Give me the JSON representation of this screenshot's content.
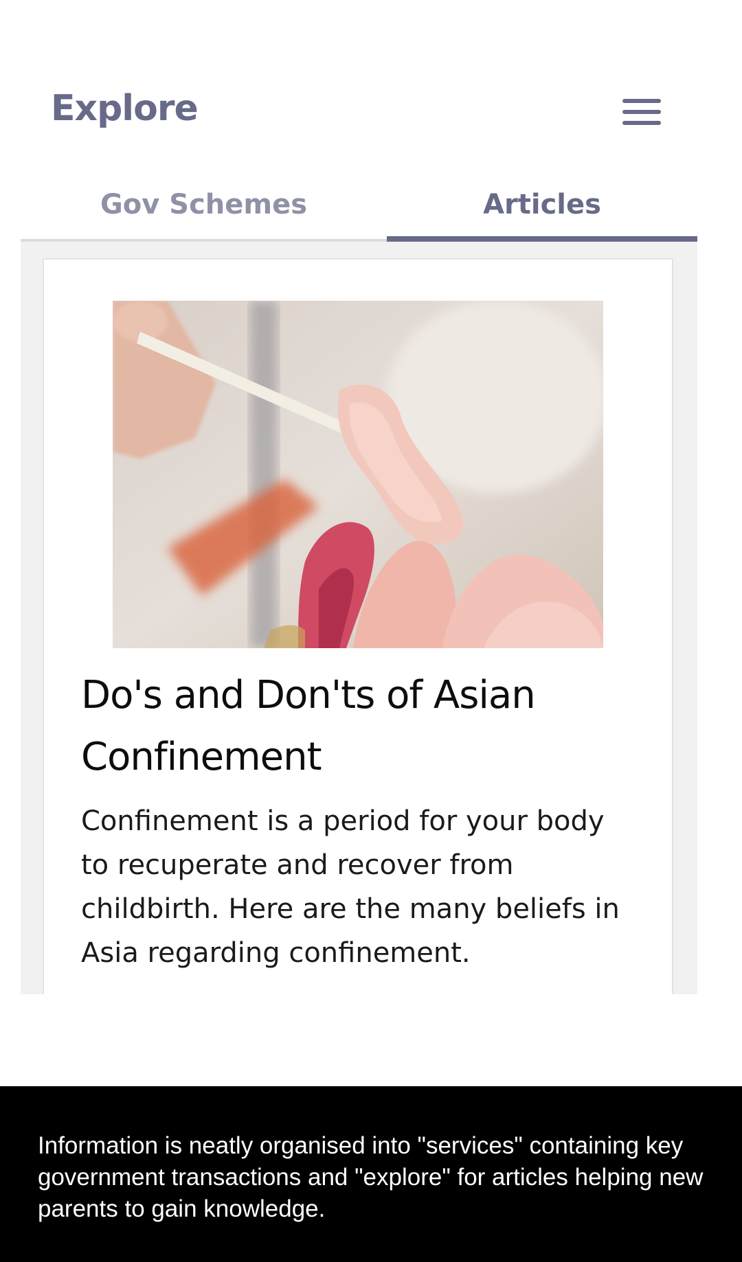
{
  "header": {
    "title": "Explore",
    "menu_icon": "hamburger-menu-icon"
  },
  "tabs": [
    {
      "label": "Gov Schemes",
      "active": false
    },
    {
      "label": "Articles",
      "active": true
    }
  ],
  "article": {
    "image_icon": "article-photo-chopsticks-raw-fish",
    "title": "Do's and Don'ts of Asian Confinement",
    "description": "Confinement is a period for your body to recuperate and recover from childbirth. Here are the many beliefs in Asia regarding confinement."
  },
  "caption": {
    "text": "Information is neatly organised into \"services\" containing key government transactions and \"explore\" for articles helping new parents to gain knowledge."
  },
  "colors": {
    "accent": "#676a88",
    "inactive_tab": "#8f91a6",
    "content_bg": "#f1f1f1",
    "caption_bg": "#000000"
  }
}
